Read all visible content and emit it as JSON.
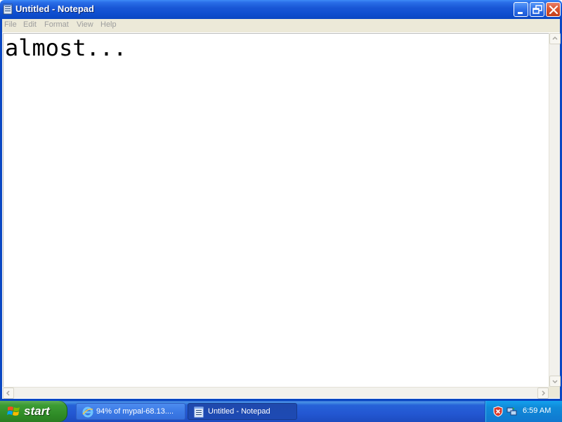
{
  "window": {
    "title": "Untitled - Notepad",
    "icon": "notepad-icon"
  },
  "menu": {
    "items": [
      "File",
      "Edit",
      "Format",
      "View",
      "Help"
    ]
  },
  "editor": {
    "text": "almost..."
  },
  "taskbar": {
    "start_label": "start",
    "tasks": [
      {
        "label": "94% of mypal-68.13....",
        "icon": "internet-explorer-icon",
        "active": false
      },
      {
        "label": "Untitled - Notepad",
        "icon": "notepad-icon",
        "active": true
      }
    ],
    "tray": {
      "icons": [
        "security-alert-icon",
        "network-icon"
      ],
      "clock": "6:59 AM"
    }
  },
  "colors": {
    "titlebar": "#0a47c2",
    "taskbar": "#2357d2",
    "start_button": "#3c9c34",
    "tray": "#0f8ad9",
    "menubar": "#ece9d8"
  }
}
